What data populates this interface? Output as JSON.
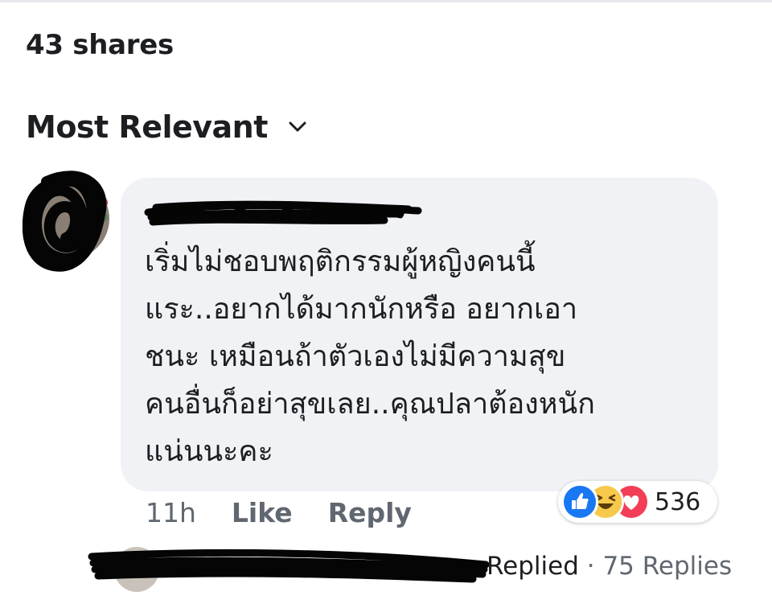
{
  "post": {
    "shares_text": "43 shares"
  },
  "sort": {
    "label": "Most Relevant",
    "chevron_icon": "chevron-down-icon"
  },
  "comment": {
    "text": "เริ่มไม่ชอบพฤติกรรมผู้หญิงคนนี้\nแระ..อยากได้มากนักหรือ อยากเอา\nชนะ เหมือนถ้าตัวเองไม่มีความสุข\nคนอื่นก็อย่าสุขเลย..คุณปลาต้องหนัก\nแน่นนะคะ",
    "time": "11h",
    "like_label": "Like",
    "reply_label": "Reply",
    "reactions": {
      "icons": [
        "like-reaction-icon",
        "haha-reaction-icon",
        "love-reaction-icon"
      ],
      "count": "536"
    }
  },
  "replies": {
    "replied_label": "Replied",
    "separator": "·",
    "count_label": "75 Replies"
  },
  "colors": {
    "bubble": "#f1f2f6",
    "muted_text": "#606770",
    "like_blue": "#1877f2",
    "love_red": "#f33e58",
    "haha_yellow": "#f7c94b"
  }
}
